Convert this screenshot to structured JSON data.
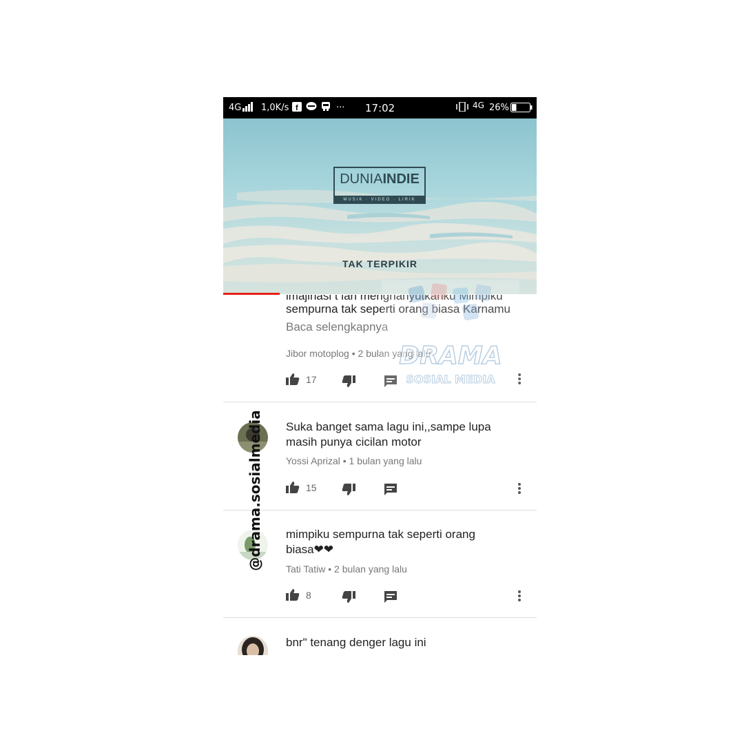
{
  "status_bar": {
    "network_left": "4G",
    "speed": "1,0K/s",
    "more": "···",
    "time": "17:02",
    "network_right": "4G",
    "battery": "26%"
  },
  "video": {
    "logo_main_light": "DUNIA",
    "logo_main_bold": "INDIE",
    "logo_sub": "MUSIK · VIDEO · LIRIK",
    "title": "TAK  TERPIKIR",
    "progress_fraction": 0.18
  },
  "comments": [
    {
      "text_partial": "imajinasi t ian menghanyutkanku Mimpiku",
      "text": "sempurna tak seperti orang biasa Karnamu",
      "read_more": "Baca selengkapnya",
      "author": "Jibor motoplog",
      "time": "2 bulan yang lalu",
      "likes": "17"
    },
    {
      "text": "Suka banget sama lagu ini,,sampe lupa masih punya cicilan motor",
      "line1": "Suka banget sama lagu ini,,sampe lupa",
      "line2": "masih punya cicilan motor",
      "author": "Yossi Aprizal",
      "time": "1 bulan yang lalu",
      "likes": "15"
    },
    {
      "line1": "mimpiku sempurna tak seperti orang",
      "line2": "biasa❤❤",
      "author": "Tati Tatiw",
      "time": "2 bulan yang lalu",
      "likes": "8"
    },
    {
      "line1": "bnr\" tenang denger lagu ini"
    }
  ],
  "separator": "•",
  "watermark": {
    "line1": "DRAMA",
    "line2": "SOSIAL MEDIA"
  },
  "handle": "@drama.sosialmedia"
}
